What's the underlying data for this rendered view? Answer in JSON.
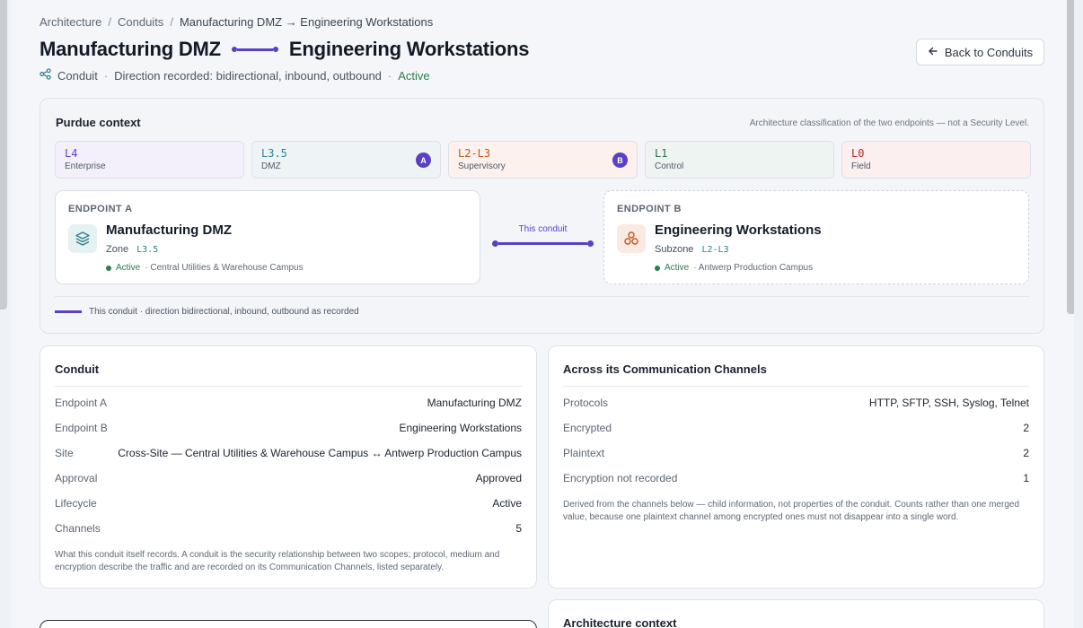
{
  "breadcrumb": {
    "items": [
      "Architecture",
      "Conduits",
      "Manufacturing DMZ → Engineering Workstations"
    ],
    "sep": "/"
  },
  "header": {
    "title_a": "Manufacturing DMZ",
    "title_b": "Engineering Workstations",
    "kind": "Conduit",
    "direction": "Direction recorded: bidirectional, inbound, outbound",
    "status": "Active",
    "dot": "·",
    "back_label": "Back to Conduits"
  },
  "purdue": {
    "title": "Purdue context",
    "note": "Architecture classification of the two endpoints — not a Security Level.",
    "levels": [
      {
        "code": "L4",
        "name": "Enterprise",
        "bg": "#f3f0fb",
        "color": "#5b3fc4",
        "badge": ""
      },
      {
        "code": "L3.5",
        "name": "DMZ",
        "bg": "#eef4f5",
        "color": "#2f7f8a",
        "badge": "A"
      },
      {
        "code": "L2-L3",
        "name": "Supervisory",
        "bg": "#fcf1ec",
        "color": "#c2571f",
        "badge": "B"
      },
      {
        "code": "L1",
        "name": "Control",
        "bg": "#eef4f1",
        "color": "#2e6e4e",
        "badge": ""
      },
      {
        "code": "L0",
        "name": "Field",
        "bg": "#fbefef",
        "color": "#b42828",
        "badge": ""
      }
    ],
    "endpoint_a": {
      "label": "ENDPOINT A",
      "name": "Manufacturing DMZ",
      "type": "Zone",
      "level": "L3.5",
      "status": "Active",
      "site": "· Central Utilities & Warehouse Campus",
      "icon": "layers-icon",
      "icon_bg": "#e6f1f2",
      "icon_color": "#2f7f8a"
    },
    "endpoint_b": {
      "label": "ENDPOINT B",
      "name": "Engineering Workstations",
      "type": "Subzone",
      "level": "L2-L3",
      "status": "Active",
      "site": "· Antwerp Production Campus",
      "icon": "cluster-icon",
      "icon_bg": "#fbeae2",
      "icon_color": "#c2571f"
    },
    "connector_label": "This conduit",
    "legend": "This conduit · direction bidirectional, inbound, outbound as recorded"
  },
  "conduit": {
    "title": "Conduit",
    "rows": [
      {
        "k": "Endpoint A",
        "v": "Manufacturing DMZ"
      },
      {
        "k": "Endpoint B",
        "v": "Engineering Workstations"
      },
      {
        "k": "Site",
        "v": "Cross-Site — Central Utilities & Warehouse Campus ↔ Antwerp Production Campus"
      },
      {
        "k": "Approval",
        "v": "Approved"
      },
      {
        "k": "Lifecycle",
        "v": "Active"
      },
      {
        "k": "Channels",
        "v": "5"
      }
    ],
    "footnote": "What this conduit itself records. A conduit is the security relationship between two scopes; protocol, medium and encryption describe the traffic and are recorded on its Communication Channels, listed separately."
  },
  "channels": {
    "title": "Across its Communication Channels",
    "rows": [
      {
        "k": "Protocols",
        "v": "HTTP, SFTP, SSH, Syslog, Telnet"
      },
      {
        "k": "Encrypted",
        "v": "2"
      },
      {
        "k": "Plaintext",
        "v": "2"
      },
      {
        "k": "Encryption not recorded",
        "v": "1"
      }
    ],
    "footnote": "Derived from the channels below — child information, not properties of the conduit. Counts rather than one merged value, because one plaintext channel among encrypted ones must not disappear into a single word."
  },
  "architecture": {
    "title": "Architecture context"
  },
  "colors": {
    "accent": "#5b3fc4",
    "active": "#2e7d4f"
  }
}
